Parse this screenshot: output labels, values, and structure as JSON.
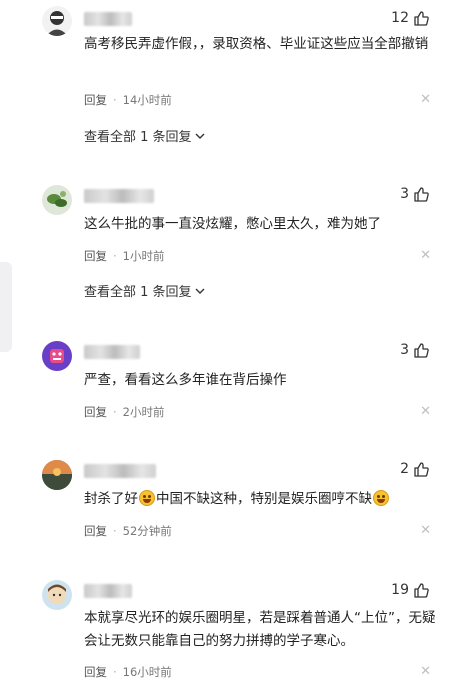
{
  "comments": [
    {
      "likes": "12",
      "text": "高考移民弄虚作假，，录取资格、毕业证这些应当全部撤销",
      "reply_label": "回复",
      "time": "14小时前",
      "view_all": "查看全部 1 条回复"
    },
    {
      "likes": "3",
      "text": "这么牛批的事一直没炫耀，憋心里太久，难为她了",
      "reply_label": "回复",
      "time": "1小时前",
      "view_all": "查看全部 1 条回复"
    },
    {
      "likes": "3",
      "text": "严查，看看这么多年谁在背后操作",
      "reply_label": "回复",
      "time": "2小时前"
    },
    {
      "likes": "2",
      "text_part1": "封杀了好",
      "text_part2": "中国不缺这种，特别是娱乐圈哼不缺",
      "reply_label": "回复",
      "time": "52分钟前"
    },
    {
      "likes": "19",
      "text": "本就享尽光环的娱乐圈明星，若是踩着普通人“上位”，无疑会让无数只能靠自己的努力拼搏的学子寒心。",
      "reply_label": "回复",
      "time": "16小时前"
    }
  ],
  "icons": {
    "like": "thumbs-up-icon",
    "close": "close-icon",
    "chevron": "chevron-down-icon",
    "emoji": "grinning-emoji-icon"
  },
  "colors": {
    "text": "#222222",
    "meta": "#777777",
    "close": "#c0c0c0"
  }
}
